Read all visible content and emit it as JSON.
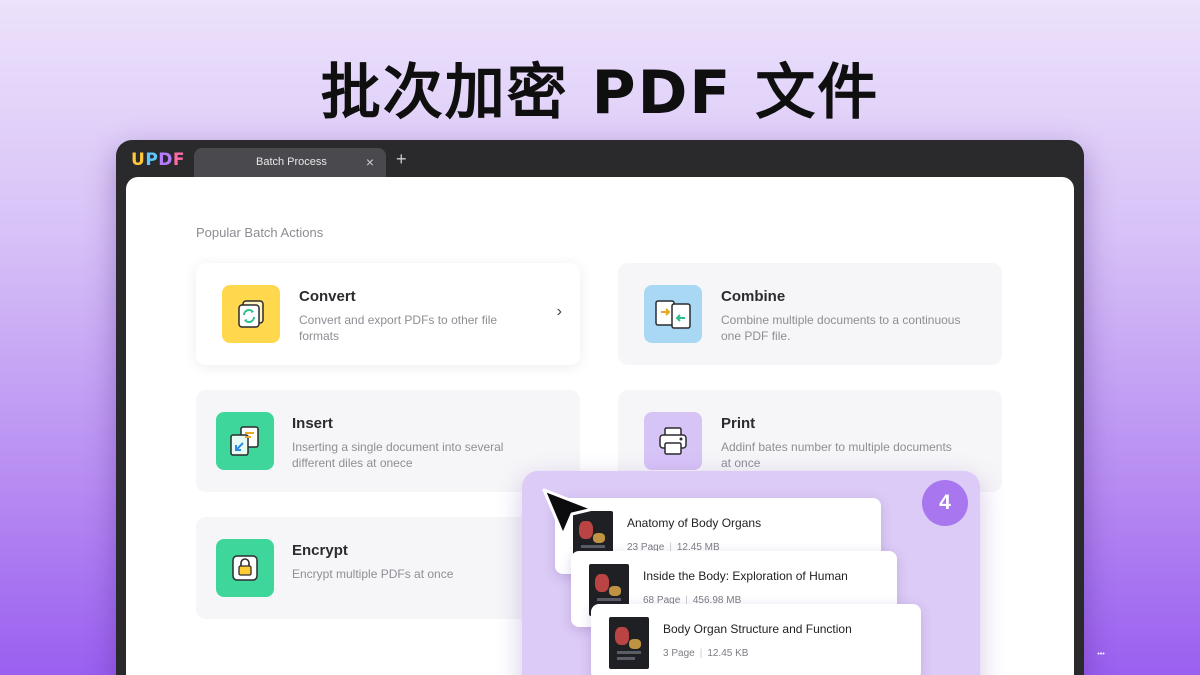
{
  "banner": {
    "title": "批次加密 PDF 文件"
  },
  "app": {
    "logo": {
      "u": "U",
      "p": "P",
      "d": "D",
      "f": "F"
    },
    "tab": {
      "label": "Batch Process",
      "close": "×",
      "add": "+"
    }
  },
  "main": {
    "section_title": "Popular Batch Actions",
    "cards": [
      {
        "title": "Convert",
        "desc": "Convert and export PDFs to other file formats",
        "icon": "convert-icon",
        "color": "#ffd84d",
        "chevron": "›"
      },
      {
        "title": "Combine",
        "desc": "Combine multiple documents to a continuous one PDF file.",
        "icon": "combine-icon",
        "color": "#a9d8f5"
      },
      {
        "title": "Insert",
        "desc": "Inserting a single document into several different diles at onece",
        "icon": "insert-icon",
        "color": "#3ed69a"
      },
      {
        "title": "Print",
        "desc": "Addinf bates number to multiple documents at once",
        "icon": "print-icon",
        "color": "#d7c4f7"
      },
      {
        "title": "Encrypt",
        "desc": "Encrypt multiple PDFs at once",
        "icon": "lock-icon",
        "color": "#3ed69a"
      }
    ]
  },
  "overlay": {
    "count": "4",
    "files": [
      {
        "title": "Anatomy of Body Organs",
        "pages": "23 Page",
        "size": "12.45 MB"
      },
      {
        "title": "Inside the Body: Exploration of Human",
        "pages": "68 Page",
        "size": "456.98 MB"
      },
      {
        "title": "Body Organ Structure and Function",
        "pages": "3 Page",
        "size": "12.45 KB"
      }
    ]
  },
  "colors": {
    "accent": "#a877ef",
    "background_bottom": "#9a5ff0"
  }
}
